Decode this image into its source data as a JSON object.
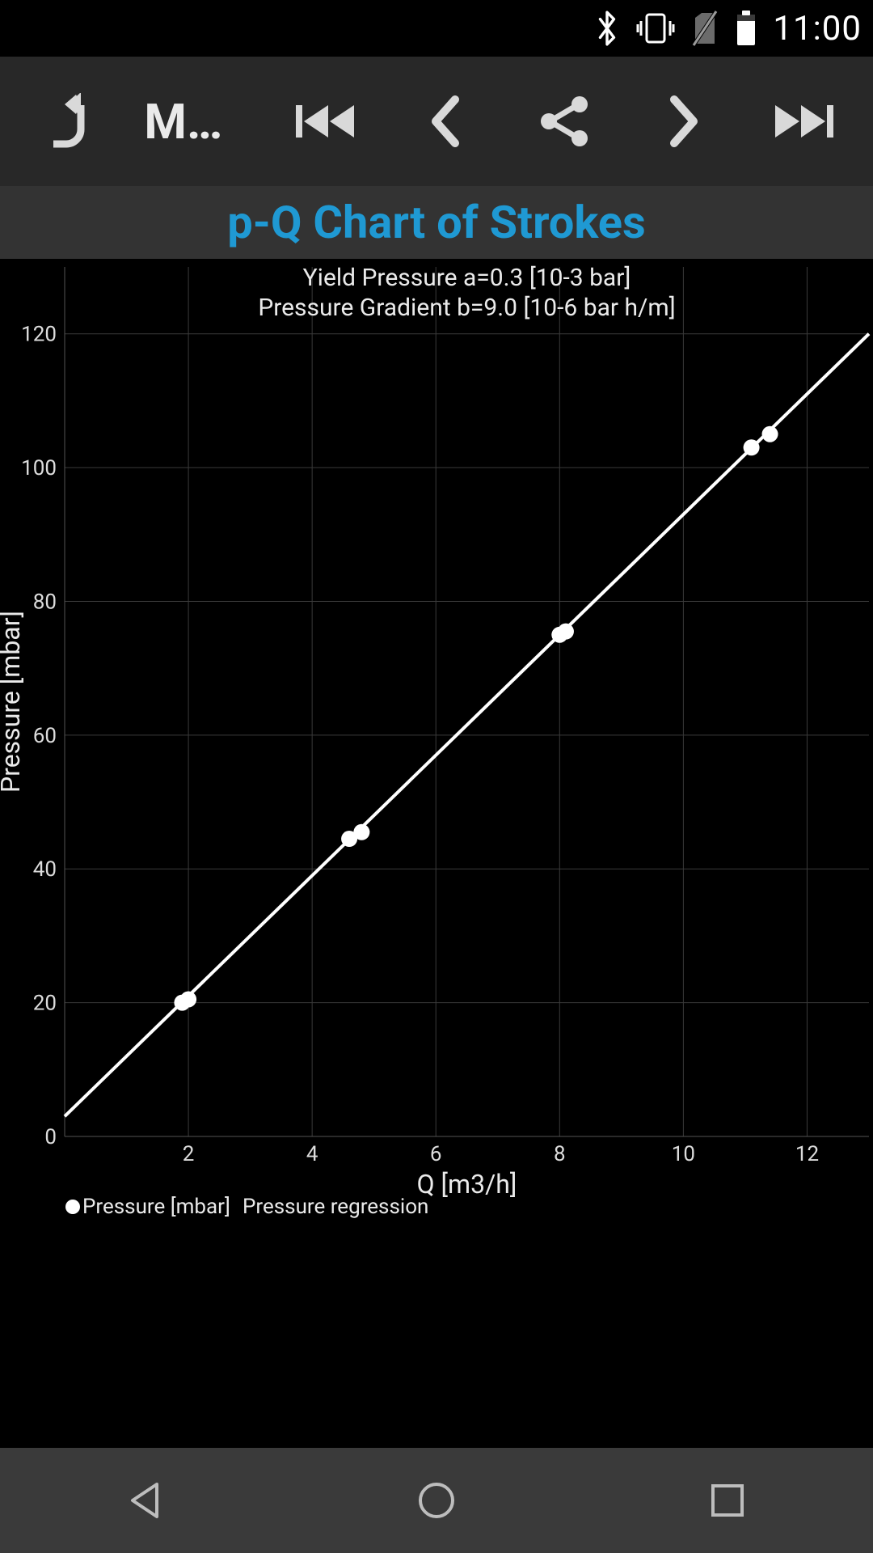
{
  "status": {
    "time": "11:00"
  },
  "toolbar": {
    "menu_label": "M…"
  },
  "page_title": "p-Q Chart of Strokes",
  "subtitle_line1": "Yield Pressure a=0.3 [10-3 bar]",
  "subtitle_line2": "Pressure Gradient b=9.0 [10-6 bar h/m]",
  "legend": {
    "series_points": "Pressure [mbar]",
    "series_line": "Pressure regression"
  },
  "axes": {
    "xlabel": "Q [m3/h]",
    "ylabel": "Pressure [mbar]"
  },
  "chart_data": {
    "type": "scatter",
    "title": "p-Q Chart of Strokes",
    "xlabel": "Q [m3/h]",
    "ylabel": "Pressure [mbar]",
    "xlim": [
      0,
      13
    ],
    "ylim": [
      0,
      130
    ],
    "xticks": [
      2,
      4,
      6,
      8,
      10,
      12
    ],
    "yticks": [
      0,
      20,
      40,
      60,
      80,
      100,
      120
    ],
    "series": [
      {
        "name": "Pressure [mbar]",
        "kind": "points",
        "points": [
          {
            "x": 1.9,
            "y": 20.0
          },
          {
            "x": 2.0,
            "y": 20.5
          },
          {
            "x": 4.6,
            "y": 44.5
          },
          {
            "x": 4.8,
            "y": 45.5
          },
          {
            "x": 8.0,
            "y": 75.0
          },
          {
            "x": 8.1,
            "y": 75.5
          },
          {
            "x": 11.1,
            "y": 103.0
          },
          {
            "x": 11.4,
            "y": 105.0
          }
        ]
      },
      {
        "name": "Pressure regression",
        "kind": "line",
        "line": {
          "slope": 9.0,
          "intercept": 3.0,
          "x0": 0,
          "x1": 13
        }
      }
    ]
  }
}
